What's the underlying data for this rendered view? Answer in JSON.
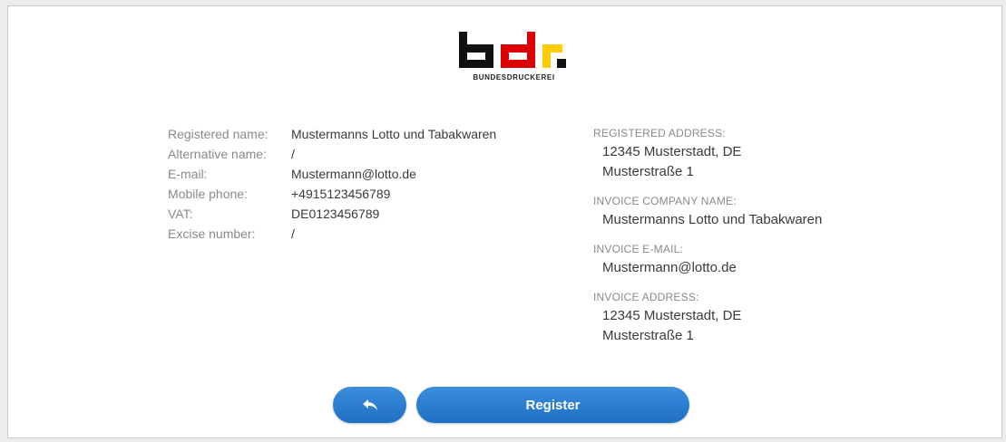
{
  "brand": {
    "name": "BUNDESDRUCKEREI",
    "logo_text": "bdr."
  },
  "company": {
    "rows": [
      {
        "label": "Registered name:",
        "value": "Mustermanns Lotto und Tabakwaren"
      },
      {
        "label": "Alternative name:",
        "value": "/"
      },
      {
        "label": "E-mail:",
        "value": "Mustermann@lotto.de"
      },
      {
        "label": "Mobile phone:",
        "value": "+4915123456789"
      },
      {
        "label": "VAT:",
        "value": "DE0123456789"
      },
      {
        "label": "Excise number:",
        "value": "/"
      }
    ]
  },
  "registered_address": {
    "label": "REGISTERED ADDRESS:",
    "line1": "12345 Musterstadt, DE",
    "line2": "Musterstraße 1"
  },
  "invoice_company": {
    "label": "INVOICE COMPANY NAME:",
    "value": "Mustermanns Lotto und Tabakwaren"
  },
  "invoice_email": {
    "label": "INVOICE E-MAIL:",
    "value": "Mustermann@lotto.de"
  },
  "invoice_address": {
    "label": "INVOICE ADDRESS:",
    "line1": "12345 Musterstadt, DE",
    "line2": "Musterstraße 1"
  },
  "actions": {
    "back_icon": "reply-arrow-icon",
    "register_label": "Register"
  },
  "colors": {
    "button": "#2a7fd4",
    "logo_black": "#111111",
    "logo_red": "#dd0000",
    "logo_gold": "#ffcc00"
  }
}
